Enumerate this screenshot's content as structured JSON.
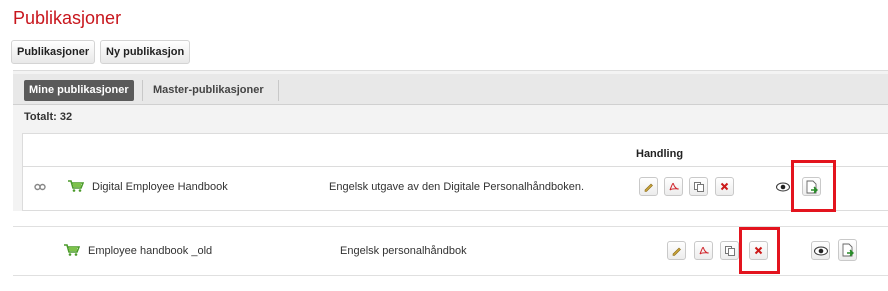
{
  "page": {
    "title": "Publikasjoner"
  },
  "top_nav": {
    "publications_label": "Publikasjoner",
    "new_label": "Ny publikasjon"
  },
  "tabs": [
    {
      "label": "Mine publikasjoner",
      "active": true
    },
    {
      "label": "Master-publikasjoner",
      "active": false
    }
  ],
  "total": "Totalt: 32",
  "table": {
    "action_header": "Handling",
    "rows": [
      {
        "name": "Digital Employee Handbook",
        "description": "Engelsk utgave av den Digitale Personalhåndboken."
      },
      {
        "name": "Employee handbook _old",
        "description": "Engelsk personalhåndbok"
      }
    ]
  },
  "icons": {
    "link": "link-icon",
    "cart": "cart-icon",
    "edit": "pencil-icon",
    "pdf": "pdf-icon",
    "copy": "copy-icon",
    "delete": "delete-icon",
    "preview": "eye-icon",
    "publish": "publish-icon"
  },
  "colors": {
    "title": "#c8161d",
    "highlight": "#e3141e",
    "active_tab": "#5a5a5a",
    "delete": "#cc1a1a",
    "cart": "#4a9a2a"
  }
}
